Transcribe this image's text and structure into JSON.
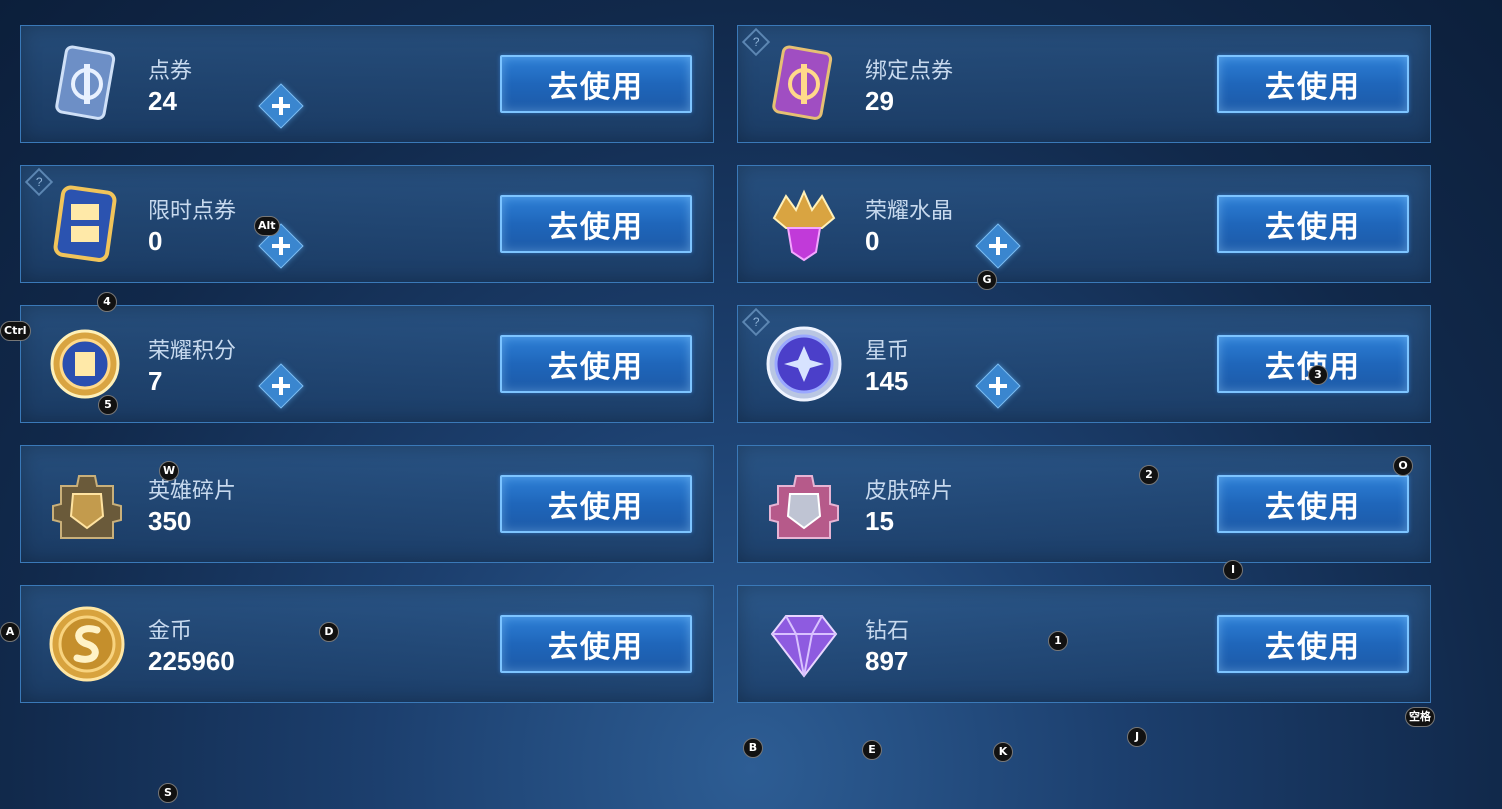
{
  "use_label": "去使用",
  "help_glyph": "?",
  "currencies": [
    {
      "name": "点券",
      "value": "24",
      "icon": "ticket-card-icon",
      "plus": true,
      "help": false
    },
    {
      "name": "绑定点券",
      "value": "29",
      "icon": "bound-ticket-card-icon",
      "plus": false,
      "help": true
    },
    {
      "name": "限时点券",
      "value": "0",
      "icon": "limited-ticket-icon",
      "plus": true,
      "help": true
    },
    {
      "name": "荣耀水晶",
      "value": "0",
      "icon": "glory-crystal-icon",
      "plus": true,
      "help": false
    },
    {
      "name": "荣耀积分",
      "value": "7",
      "icon": "glory-points-icon",
      "plus": true,
      "help": false
    },
    {
      "name": "星币",
      "value": "145",
      "icon": "star-coin-icon",
      "plus": true,
      "help": true
    },
    {
      "name": "英雄碎片",
      "value": "350",
      "icon": "hero-fragment-icon",
      "plus": false,
      "help": false
    },
    {
      "name": "皮肤碎片",
      "value": "15",
      "icon": "skin-fragment-icon",
      "plus": false,
      "help": false
    },
    {
      "name": "金币",
      "value": "225960",
      "icon": "gold-coin-icon",
      "plus": false,
      "help": false
    },
    {
      "name": "钻石",
      "value": "897",
      "icon": "diamond-icon",
      "plus": false,
      "help": false
    }
  ],
  "key_hints": [
    "4",
    "Alt",
    "Ctrl",
    "5",
    "G",
    "3",
    "W",
    "2",
    "O",
    "I",
    "A",
    "D",
    "1",
    "空格",
    "B",
    "E",
    "K",
    "J",
    "S"
  ]
}
